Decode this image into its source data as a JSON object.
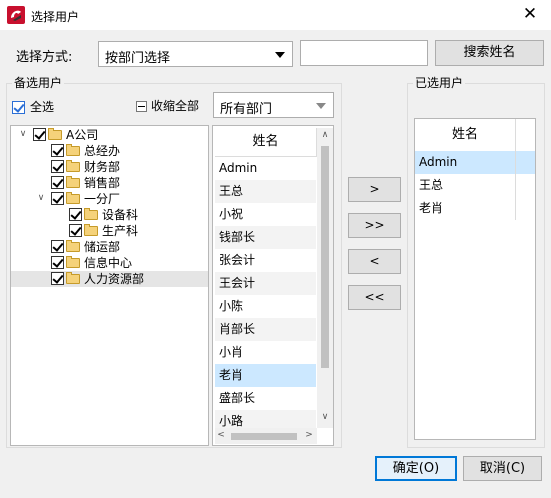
{
  "window": {
    "title": "选择用户",
    "close_glyph": "✕",
    "icon": "app-logo-icon"
  },
  "search": {
    "mode_label": "选择方式:",
    "mode_value": "按部门选择",
    "input_value": "",
    "button_label": "搜索姓名"
  },
  "candidates": {
    "group_title": "备选用户",
    "select_all_label": "全选",
    "collapse_label": "收缩全部",
    "dept_filter_value": "所有部门",
    "tree": [
      {
        "label": "A公司",
        "level": 0,
        "expander": "∨",
        "checked": true
      },
      {
        "label": "总经办",
        "level": 1,
        "expander": "",
        "checked": true
      },
      {
        "label": "财务部",
        "level": 1,
        "expander": "",
        "checked": true
      },
      {
        "label": "销售部",
        "level": 1,
        "expander": "",
        "checked": true
      },
      {
        "label": "一分厂",
        "level": 1,
        "expander": "∨",
        "checked": true
      },
      {
        "label": "设备科",
        "level": 2,
        "expander": "",
        "checked": true
      },
      {
        "label": "生产科",
        "level": 2,
        "expander": "",
        "checked": true
      },
      {
        "label": "储运部",
        "level": 1,
        "expander": "",
        "checked": true
      },
      {
        "label": "信息中心",
        "level": 1,
        "expander": "",
        "checked": true
      },
      {
        "label": "人力资源部",
        "level": 1,
        "expander": "",
        "checked": true,
        "selected": true
      }
    ],
    "list_header": "姓名",
    "users": [
      "Admin",
      "王总",
      "小祝",
      "钱部长",
      "张会计",
      "王会计",
      "小陈",
      "肖部长",
      "小肖",
      "老肖",
      "盛部长",
      "小路"
    ],
    "selected_user_index": 9
  },
  "moves": {
    "add": ">",
    "add_all": ">>",
    "remove": "<",
    "remove_all": "<<"
  },
  "chosen": {
    "group_title": "已选用户",
    "list_header": "姓名",
    "users": [
      "Admin",
      "王总",
      "老肖"
    ],
    "selected_index": 0
  },
  "footer": {
    "ok_label": "确定(O)",
    "cancel_label": "取消(C)"
  }
}
